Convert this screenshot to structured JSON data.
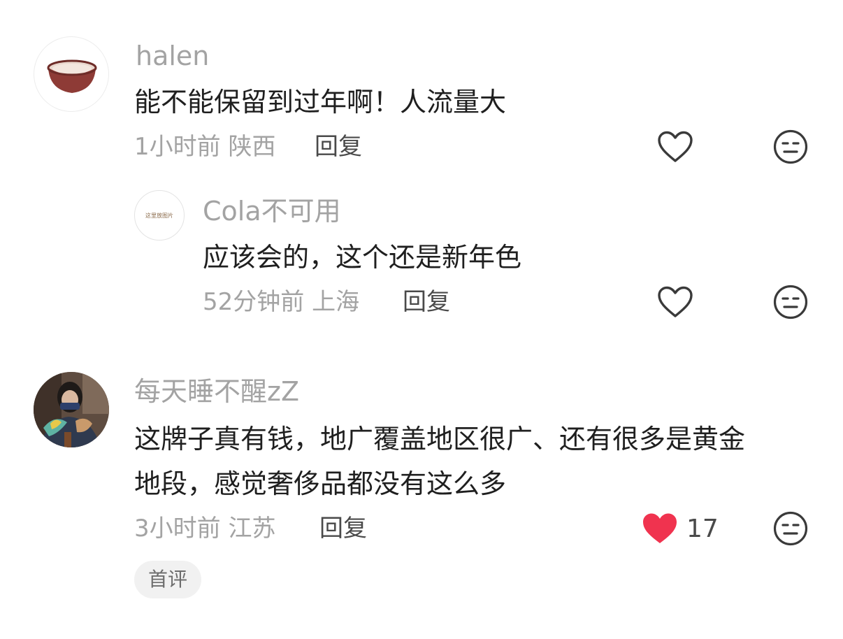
{
  "comments": [
    {
      "username": "halen",
      "text": "能不能保留到过年啊！人流量大",
      "time": "1小时前",
      "location": "陕西",
      "reply_label": "回复",
      "liked": false,
      "replies": [
        {
          "username": "Cola不可用",
          "avatar_text": "这里放图片",
          "text": "应该会的，这个还是新年色",
          "time": "52分钟前",
          "location": "上海",
          "reply_label": "回复",
          "liked": false
        }
      ]
    },
    {
      "username": "每天睡不醒zZ",
      "text_lines": [
        "这牌子真有钱，地广覆盖地区很广、还有很多是黄金",
        "地段，感觉奢侈品都没有这么多"
      ],
      "time": "3小时前",
      "location": "江苏",
      "reply_label": "回复",
      "liked": true,
      "like_count": "17",
      "badge": "首评"
    }
  ],
  "colors": {
    "like_active": "#f0334f",
    "icon_stroke": "#3a3a3a",
    "muted_text": "#a3a3a3"
  },
  "icons": [
    "heart-outline-icon",
    "heart-filled-icon",
    "dislike-face-icon"
  ]
}
